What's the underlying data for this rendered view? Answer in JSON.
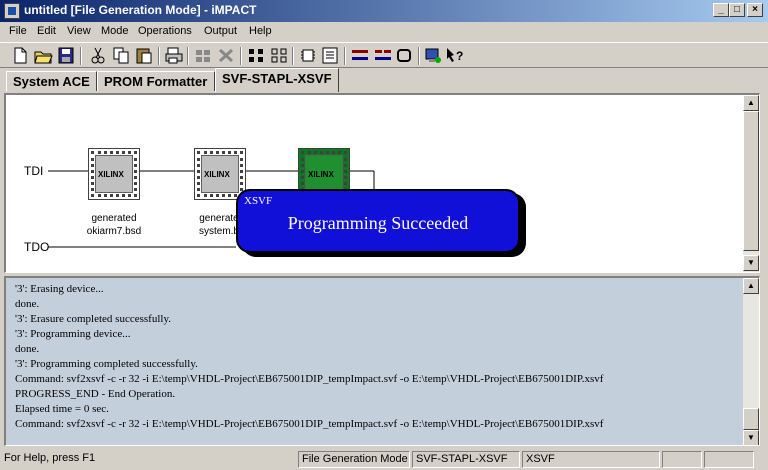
{
  "window": {
    "title": "untitled [File Generation Mode] - iMPACT"
  },
  "menu": [
    "File",
    "Edit",
    "View",
    "Mode",
    "Operations",
    "Output",
    "Help"
  ],
  "toolbar": [
    "new-icon",
    "open-icon",
    "save-icon",
    "cut-icon",
    "copy-icon",
    "paste-icon",
    "print-icon",
    "chain-icon",
    "chain2-icon",
    "grid-icon",
    "grid2-icon",
    "chip-icon",
    "list-icon",
    "connect-icon",
    "disconnect-icon",
    "cable-icon",
    "program-icon",
    "help-context-icon"
  ],
  "tabs": [
    "System ACE",
    "PROM Formatter",
    "SVF-STAPL-XSVF"
  ],
  "diagram": {
    "tdi": "TDI",
    "tdo": "TDO",
    "devices": [
      {
        "chip": "XILINX",
        "label1": "generated",
        "label2": "okiarm7.bsd"
      },
      {
        "chip": "XILINX",
        "label1": "generate",
        "label2": "system.b"
      },
      {
        "chip": "XILINX",
        "label1": "",
        "label2": ""
      }
    ],
    "popup": {
      "title": "XSVF",
      "message": "Programming Succeeded"
    }
  },
  "console": [
    "'3': Erasing device...",
    "done.",
    "'3': Erasure completed successfully.",
    "'3': Programming device...",
    "done.",
    "'3': Programming completed successfully.",
    "Command: svf2xsvf -c -r 32 -i E:\\temp\\VHDL-Project\\EB675001DIP_tempImpact.svf -o E:\\temp\\VHDL-Project\\EB675001DIP.xsvf",
    "PROGRESS_END - End Operation.",
    "Elapsed time =      0 sec.",
    "Command: svf2xsvf -c -r 32 -i E:\\temp\\VHDL-Project\\EB675001DIP_tempImpact.svf -o E:\\temp\\VHDL-Project\\EB675001DIP.xsvf"
  ],
  "status": {
    "help": "For Help, press F1",
    "mode": "File Generation Mode",
    "tab": "SVF-STAPL-XSVF",
    "format": "XSVF"
  }
}
